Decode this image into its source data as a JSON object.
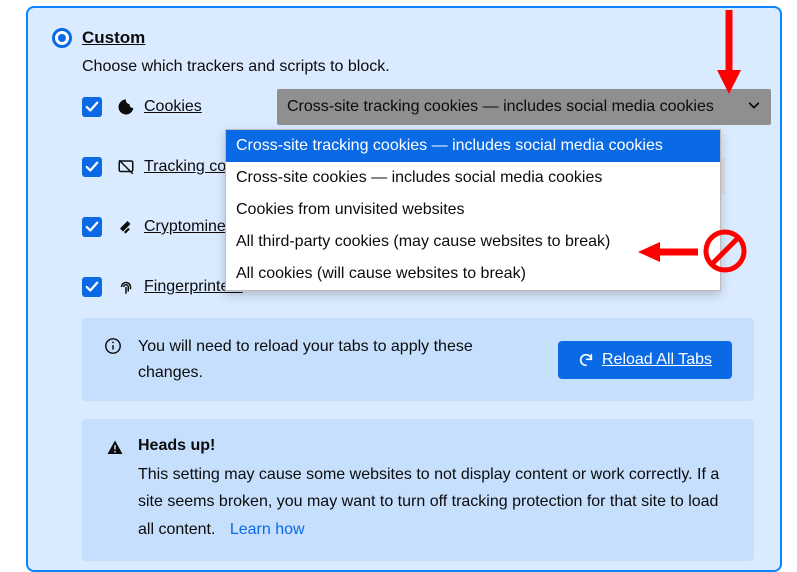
{
  "header": {
    "title": "Custom",
    "subtitle": "Choose which trackers and scripts to block."
  },
  "options": {
    "cookies": {
      "label": "Cookies"
    },
    "tracking": {
      "label": "Tracking con"
    },
    "crypto": {
      "label": "Cryptominer"
    },
    "finger": {
      "label": "Fingerprinters"
    }
  },
  "cookies_select": {
    "current": "Cross-site tracking cookies — includes social media cookies",
    "items": [
      "Cross-site tracking cookies — includes social media cookies",
      "Cross-site cookies — includes social media cookies",
      "Cookies from unvisited websites",
      "All third-party cookies (may cause websites to break)",
      "All cookies (will cause websites to break)"
    ]
  },
  "info": {
    "text": "You will need to reload your tabs to apply these changes.",
    "reload_label": "Reload All Tabs"
  },
  "heads": {
    "title": "Heads up!",
    "body": "This setting may cause some websites to not display content or work correctly. If a site seems broken, you may want to turn off tracking protection for that site to load all content.",
    "learn": "Learn how"
  }
}
